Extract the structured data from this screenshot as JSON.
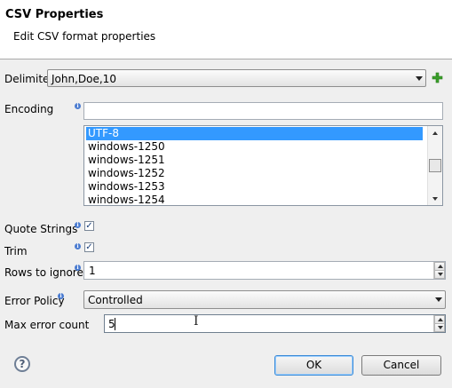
{
  "dialog": {
    "title": "CSV Properties",
    "subtitle": "Edit CSV format properties"
  },
  "delimiter": {
    "label": "Delimiter",
    "value": "John,Doe,10",
    "add_icon": "plus-icon"
  },
  "encoding": {
    "label": "Encoding",
    "filter_value": "",
    "options": [
      "UTF-8",
      "windows-1250",
      "windows-1251",
      "windows-1252",
      "windows-1253",
      "windows-1254"
    ],
    "selected": "UTF-8"
  },
  "quote_strings": {
    "label": "Quote Strings",
    "checked": true,
    "mark": "✓"
  },
  "trim": {
    "label": "Trim",
    "checked": true,
    "mark": "✓"
  },
  "rows_to_ignore": {
    "label": "Rows to ignore",
    "value": "1"
  },
  "error_policy": {
    "label": "Error Policy",
    "value": "Controlled"
  },
  "max_error_count": {
    "label": "Max error count",
    "value": "5"
  },
  "buttons": {
    "ok": "OK",
    "cancel": "Cancel",
    "help": "?"
  },
  "info_glyph": "i",
  "colors": {
    "selection": "#3399ff",
    "default_button_border": "#3a8ad6",
    "add_icon": "#3aa12a",
    "info_icon": "#4a7bd0"
  }
}
